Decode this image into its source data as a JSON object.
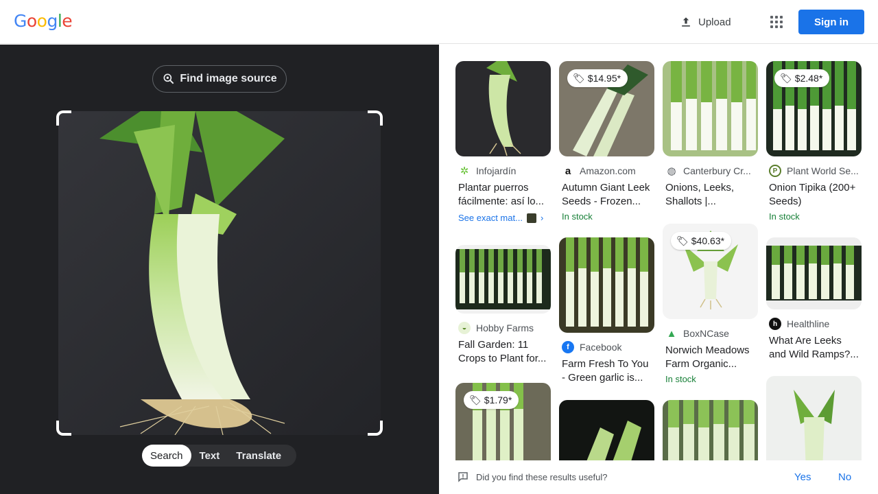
{
  "header": {
    "logo_letters": [
      "G",
      "o",
      "o",
      "g",
      "l",
      "e"
    ],
    "upload_label": "Upload",
    "signin_label": "Sign in"
  },
  "lens": {
    "find_source_label": "Find image source",
    "modes": [
      {
        "label": "Search",
        "active": true
      },
      {
        "label": "Text",
        "active": false
      },
      {
        "label": "Translate",
        "active": false
      }
    ]
  },
  "results": [
    {
      "source": "Infojardín",
      "title": "Plantar puerros fácilmente: así lo...",
      "exact_match": "See exact mat..."
    },
    {
      "source": "Amazon.com",
      "title": "Autumn Giant Leek Seeds - Frozen...",
      "price": "$14.95*",
      "stock": "In stock"
    },
    {
      "source": "Canterbury Cr...",
      "title": "Onions, Leeks, Shallots |..."
    },
    {
      "source": "Plant World Se...",
      "title": "Onion Tipika (200+ Seeds)",
      "price": "$2.48*",
      "stock": "In stock"
    },
    {
      "source": "Hobby Farms",
      "title": "Fall Garden: 11 Crops to Plant for..."
    },
    {
      "source": "Facebook",
      "title": "Farm Fresh To You - Green garlic is..."
    },
    {
      "source": "BoxNCase",
      "title": "Norwich Meadows Farm Organic...",
      "price": "$40.63*",
      "stock": "In stock"
    },
    {
      "source": "Healthline",
      "title": "What Are Leeks and Wild Ramps?..."
    },
    {
      "price": "$1.79*"
    },
    {},
    {},
    {}
  ],
  "feedback": {
    "question": "Did you find these results useful?",
    "yes_label": "Yes",
    "no_label": "No"
  },
  "colors": {
    "accent": "#1a73e8",
    "dark_panel": "#202124",
    "stock_green": "#188038"
  }
}
